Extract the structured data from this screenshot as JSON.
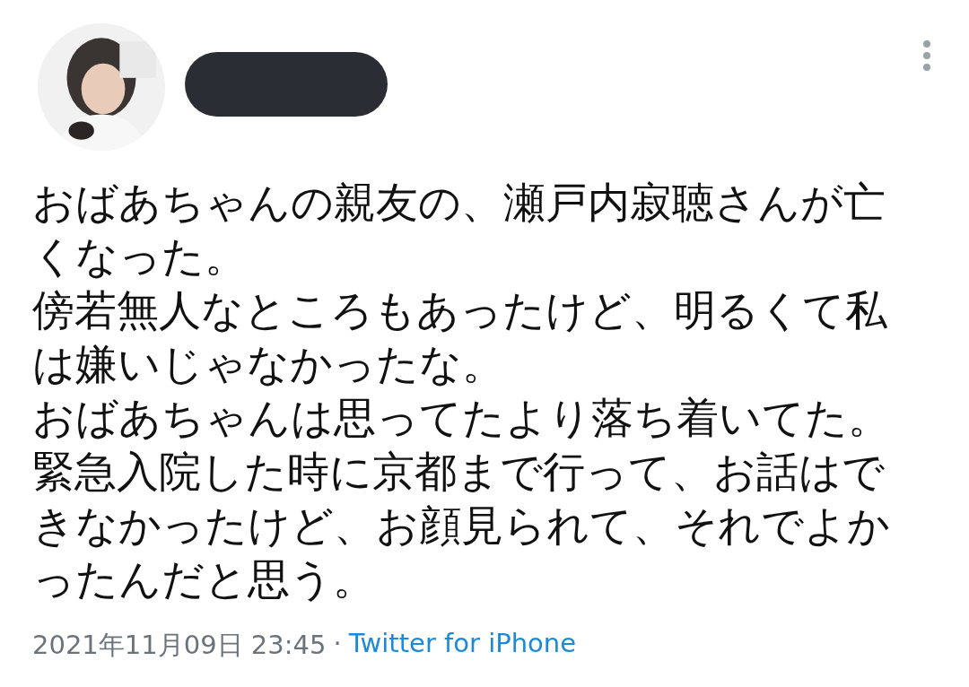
{
  "tweet": {
    "author": {
      "redacted": true
    },
    "paragraphs": [
      "おばあちゃんの親友の、瀬戸内寂聴さんが亡くなった。",
      "傍若無人なところもあったけど、明るくて私は嫌いじゃなかったな。",
      "おばあちゃんは思ってたより落ち着いてた。",
      "緊急入院した時に京都まで行って、お話はできなかったけど、お顔見られて、それでよかったんだと思う。"
    ],
    "timestamp": "2021年11月09日 23:45",
    "separator": "·",
    "source": "Twitter for iPhone"
  }
}
